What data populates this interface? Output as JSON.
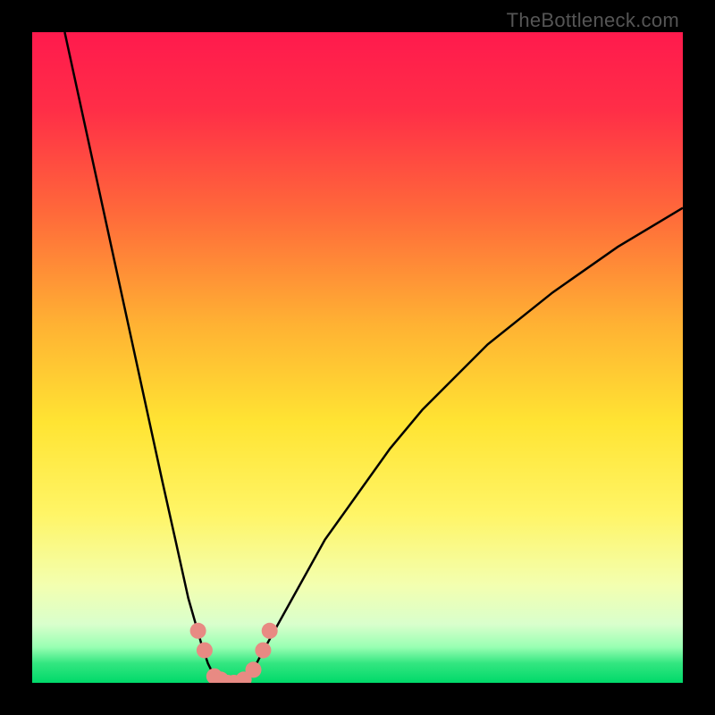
{
  "watermark": "TheBottleneck.com",
  "chart_data": {
    "type": "line",
    "title": "",
    "xlabel": "",
    "ylabel": "",
    "xlim": [
      0,
      100
    ],
    "ylim": [
      0,
      100
    ],
    "grid": false,
    "legend": false,
    "series": [
      {
        "name": "bottleneck-curve",
        "x": [
          5,
          10,
          15,
          20,
          22,
          24,
          26,
          27,
          28,
          29,
          30,
          31,
          32,
          33,
          34,
          35,
          40,
          45,
          50,
          55,
          60,
          70,
          80,
          90,
          100
        ],
        "y": [
          100,
          77,
          54,
          31,
          22,
          13,
          6,
          3,
          1,
          0,
          0,
          0,
          0,
          1,
          2,
          4,
          13,
          22,
          29,
          36,
          42,
          52,
          60,
          67,
          73
        ]
      }
    ],
    "markers": [
      {
        "name": "point-a",
        "x": 25.5,
        "y": 8
      },
      {
        "name": "point-b",
        "x": 26.5,
        "y": 5
      },
      {
        "name": "point-c",
        "x": 28,
        "y": 1
      },
      {
        "name": "point-d",
        "x": 29,
        "y": 0.5
      },
      {
        "name": "point-e",
        "x": 30,
        "y": 0
      },
      {
        "name": "point-f",
        "x": 31,
        "y": 0
      },
      {
        "name": "point-g",
        "x": 32.5,
        "y": 0.5
      },
      {
        "name": "point-h",
        "x": 34,
        "y": 2
      },
      {
        "name": "point-i",
        "x": 35.5,
        "y": 5
      },
      {
        "name": "point-j",
        "x": 36.5,
        "y": 8
      }
    ],
    "colors": {
      "gradient_top": "#ff1a4d",
      "gradient_mid1": "#ff7a33",
      "gradient_mid2": "#ffe033",
      "gradient_mid3": "#f5ff99",
      "gradient_bottom": "#00e676",
      "curve": "#000000",
      "marker": "#e88a83"
    }
  }
}
